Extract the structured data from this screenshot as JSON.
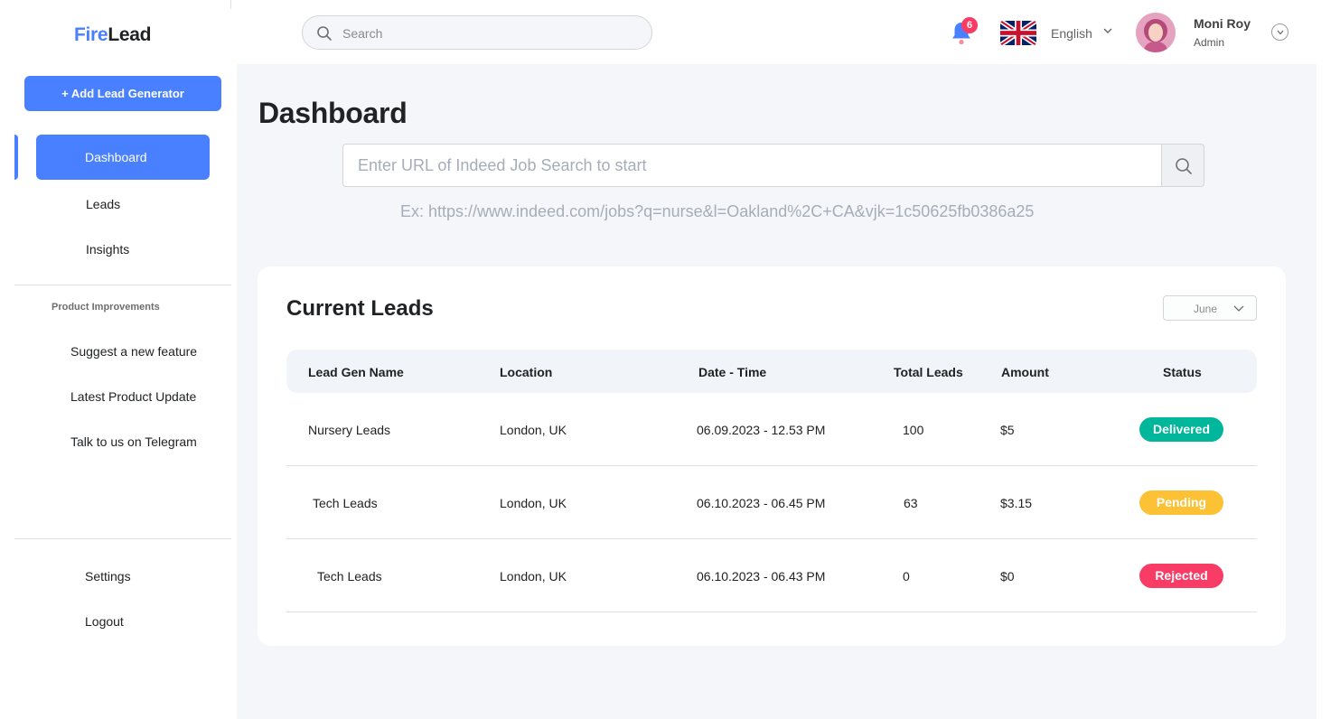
{
  "brand": {
    "fire": "Fire",
    "lead": "Lead"
  },
  "header": {
    "search_placeholder": "Search",
    "notification_count": "6",
    "language": "English",
    "user": {
      "name": "Moni Roy",
      "role": "Admin"
    }
  },
  "sidebar": {
    "add_button": "+ Add Lead Generator",
    "nav": [
      {
        "label": "Dashboard",
        "active": true
      },
      {
        "label": "Leads"
      },
      {
        "label": "Insights"
      }
    ],
    "section_title": "Product Improvements",
    "section_items": [
      {
        "label": "Suggest a new feature"
      },
      {
        "label": "Latest Product Update"
      },
      {
        "label": "Talk to us on Telegram"
      }
    ],
    "bottom_items": [
      {
        "label": "Settings"
      },
      {
        "label": "Logout"
      }
    ]
  },
  "main": {
    "title": "Dashboard",
    "url_placeholder": "Enter URL of Indeed Job Search to start",
    "example": "Ex: https://www.indeed.com/jobs?q=nurse&l=Oakland%2C+CA&vjk=1c50625fb0386a25"
  },
  "leads": {
    "title": "Current Leads",
    "month": "June",
    "columns": [
      "Lead Gen Name",
      "Location",
      "Date - Time",
      "Total Leads",
      "Amount",
      "Status"
    ],
    "rows": [
      {
        "name": "Nursery Leads",
        "location": "London, UK",
        "datetime": "06.09.2023 - 12.53 PM",
        "total": "100",
        "amount": "$5",
        "status": "Delivered"
      },
      {
        "name": "Tech Leads",
        "location": "London, UK",
        "datetime": "06.10.2023 - 06.45 PM",
        "total": "63",
        "amount": "$3.15",
        "status": "Pending"
      },
      {
        "name": "Tech Leads",
        "location": "London, UK",
        "datetime": "06.10.2023 - 06.43 PM",
        "total": "0",
        "amount": "$0",
        "status": "Rejected"
      }
    ]
  },
  "colors": {
    "accent": "#4880ff",
    "delivered": "#00b69b",
    "pending": "#fdc136",
    "rejected": "#f93c65"
  }
}
